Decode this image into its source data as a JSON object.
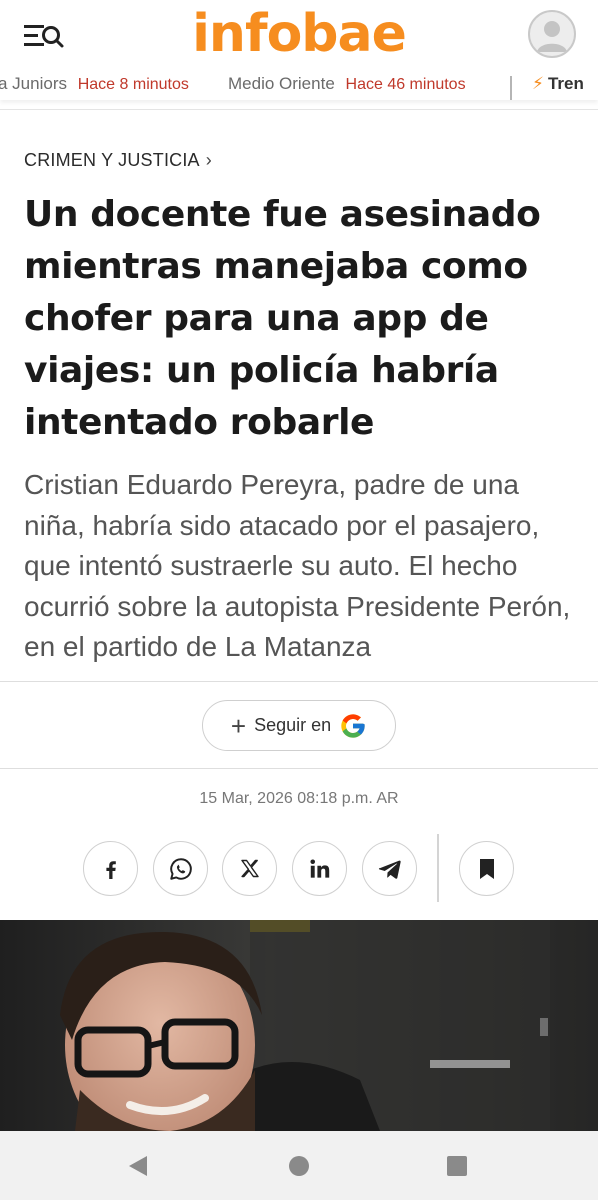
{
  "header": {
    "logo": "infobae",
    "menu_icon": "menu-search-icon",
    "avatar_icon": "user-avatar-icon"
  },
  "ticker": {
    "items": [
      {
        "topic": "a Juniors",
        "time": "Hace 8 minutos"
      },
      {
        "topic": "Medio Oriente",
        "time": "Hace 46 minutos"
      }
    ],
    "trending_label": "Tren"
  },
  "article": {
    "section": "CRIMEN Y JUSTICIA",
    "headline": "Un docente fue asesinado mientras manejaba como chofer para una app de viajes: un policía habría intentado robarle",
    "lead": "Cristian Eduardo Pereyra, padre de una niña, habría sido atacado por el pasajero, que intentó sustraerle su auto. El hecho ocurrió sobre la autopista Presidente Perón, en el partido de La Matanza",
    "follow_label": "Seguir en",
    "date": "15 Mar, 2026 08:18 p.m. AR"
  },
  "share": {
    "buttons": [
      "facebook-icon",
      "whatsapp-icon",
      "x-icon",
      "linkedin-icon",
      "telegram-icon"
    ],
    "bookmark": "bookmark-icon"
  },
  "colors": {
    "brand": "#f68d1f",
    "ticker_time": "#c0392b"
  },
  "navbar": {
    "buttons": [
      "back-icon",
      "home-icon",
      "recents-icon"
    ]
  }
}
